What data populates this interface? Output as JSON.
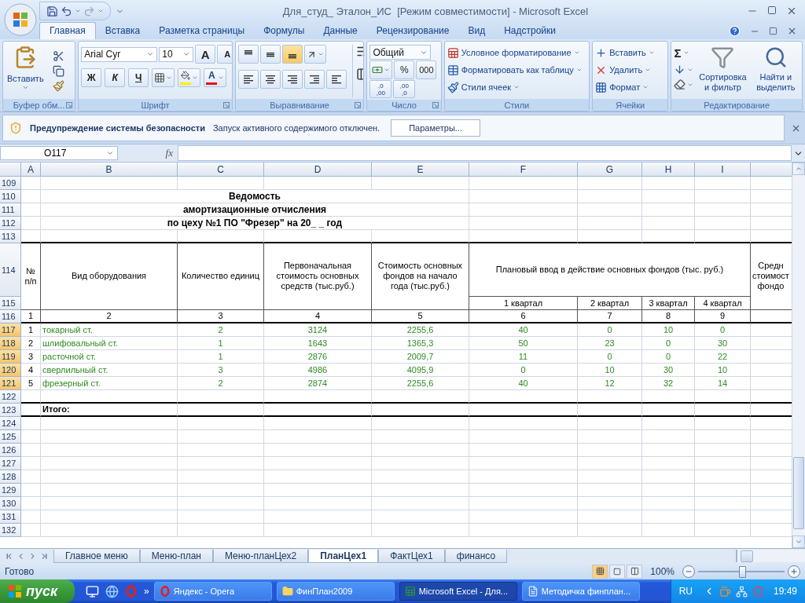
{
  "window": {
    "title": "Для_студ_ Эталон_ИС  [Режим совместимости] - Microsoft Excel"
  },
  "ribbon_tabs": [
    {
      "label": "Главная",
      "selected": true
    },
    {
      "label": "Вставка",
      "selected": false
    },
    {
      "label": "Разметка страницы",
      "selected": false
    },
    {
      "label": "Формулы",
      "selected": false
    },
    {
      "label": "Данные",
      "selected": false
    },
    {
      "label": "Рецензирование",
      "selected": false
    },
    {
      "label": "Вид",
      "selected": false
    },
    {
      "label": "Надстройки",
      "selected": false
    }
  ],
  "clipboard": {
    "paste": "Вставить",
    "label": "Буфер обм..."
  },
  "font": {
    "name": "Arial Cyr",
    "size": "10",
    "grow": "A",
    "shrink": "A",
    "bold": "Ж",
    "italic": "К",
    "underline": "Ч",
    "color_letter": "A",
    "label": "Шрифт"
  },
  "alignment": {
    "vertical": [
      {
        "selected": false
      },
      {
        "selected": false
      },
      {
        "selected": true
      }
    ],
    "horizontal": [
      {
        "selected": false
      },
      {
        "selected": false
      },
      {
        "selected": false
      }
    ],
    "label": "Выравнивание"
  },
  "number": {
    "format": "Общий",
    "percent": "%",
    "thousands": "000",
    "decimals": [
      [
        ",0",
        ",00"
      ],
      [
        ",00",
        ",0"
      ]
    ],
    "label": "Число"
  },
  "styles": {
    "items": [
      "Условное форматирование",
      "Форматировать как таблицу",
      "Стили ячеек"
    ],
    "label": "Стили"
  },
  "cells": {
    "items": [
      "Вставить",
      "Удалить",
      "Формат"
    ],
    "label": "Ячейки"
  },
  "editing": {
    "sum": "Σ",
    "sort": "Сортировка и фильтр",
    "find": "Найти и выделить",
    "label": "Редактирование"
  },
  "security_bar": {
    "title": "Предупреждение системы безопасности",
    "message": "Запуск активного содержимого отключен.",
    "button": "Параметры..."
  },
  "formula_bar": {
    "name_box": "O117",
    "fx": "fx"
  },
  "sheet": {
    "columns": [
      "A",
      "B",
      "C",
      "D",
      "E",
      "F",
      "G",
      "H",
      "I"
    ],
    "row_numbers": [
      {
        "label": "109",
        "selected": false
      },
      {
        "label": "110",
        "selected": false
      },
      {
        "label": "111",
        "selected": false
      },
      {
        "label": "112",
        "selected": false
      },
      {
        "label": "113",
        "selected": false
      },
      {
        "label": "114",
        "selected": false
      },
      {
        "label": "115",
        "selected": false
      },
      {
        "label": "116",
        "selected": false
      },
      {
        "label": "117",
        "selected": true
      },
      {
        "label": "118",
        "selected": true
      },
      {
        "label": "119",
        "selected": true
      },
      {
        "label": "120",
        "selected": true
      },
      {
        "label": "121",
        "selected": true
      },
      {
        "label": "122",
        "selected": false
      },
      {
        "label": "123",
        "selected": false
      },
      {
        "label": "124",
        "selected": false
      },
      {
        "label": "125",
        "selected": false
      },
      {
        "label": "126",
        "selected": false
      },
      {
        "label": "127",
        "selected": false
      },
      {
        "label": "128",
        "selected": false
      },
      {
        "label": "129",
        "selected": false
      },
      {
        "label": "130",
        "selected": false
      },
      {
        "label": "131",
        "selected": false
      },
      {
        "label": "132",
        "selected": false
      }
    ],
    "title_lines": [
      "Ведомость",
      "амортизационные отчисления",
      "по цеху №1 ПО \"Фрезер\" на 20_ _ год"
    ],
    "header": {
      "number": "№ п/п",
      "equipment": "Вид оборудования",
      "quantity": "Количество единиц",
      "initial_cost": "Первоначальная стоимость основных средств (тыс.руб.)",
      "start_cost": "Стоимость основных фондов на начало года (тыс.руб.)",
      "planned": "Плановый ввод в действие основных фондов (тыс. руб.)",
      "quarters": [
        "1 квартал",
        "2 квартал",
        "3 квартал",
        "4 квартал"
      ],
      "column_10": [
        "Средн",
        "стоимост",
        "фондо"
      ]
    },
    "column_numbers": [
      "1",
      "2",
      "3",
      "4",
      "5",
      "6",
      "7",
      "8",
      "9"
    ],
    "rows": [
      {
        "cells": [
          "1",
          "токарный ст.",
          "2",
          "3124",
          "2255,6",
          "40",
          "0",
          "10",
          "0"
        ]
      },
      {
        "cells": [
          "2",
          "шлифовальный ст.",
          "1",
          "1643",
          "1365,3",
          "50",
          "23",
          "0",
          "30"
        ]
      },
      {
        "cells": [
          "3",
          "расточной ст.",
          "1",
          "2876",
          "2009,7",
          "11",
          "0",
          "0",
          "22"
        ]
      },
      {
        "cells": [
          "4",
          "сверлильный ст.",
          "3",
          "4986",
          "4095,9",
          "0",
          "10",
          "30",
          "10"
        ]
      },
      {
        "cells": [
          "5",
          "фрезерный ст.",
          "2",
          "2874",
          "2255,6",
          "40",
          "12",
          "32",
          "14"
        ]
      }
    ],
    "total_label": "Итого:"
  },
  "sheet_tabs": [
    {
      "label": "Главное меню",
      "selected": false
    },
    {
      "label": "Меню-план",
      "selected": false
    },
    {
      "label": "Меню-планЦех2",
      "selected": false
    },
    {
      "label": "ПланЦех1",
      "selected": true
    },
    {
      "label": "ФактЦех1",
      "selected": false
    },
    {
      "label": "финансо",
      "selected": false
    }
  ],
  "status_bar": {
    "status": "Готово",
    "views": [
      {
        "selected": true
      },
      {
        "selected": false
      },
      {
        "selected": false
      }
    ],
    "zoom": "100%",
    "zoom_slider": {
      "level": 0.5
    }
  },
  "taskbar": {
    "start": "пуск",
    "more": "»",
    "windows": [
      {
        "label": "Яндекс - Opera",
        "selected": false
      },
      {
        "label": "ФинПлан2009",
        "selected": false
      },
      {
        "label": "Microsoft Excel - Для...",
        "selected": true
      },
      {
        "label": "Методичка финплан...",
        "selected": false
      }
    ],
    "language": "RU",
    "clock": "19:49"
  }
}
